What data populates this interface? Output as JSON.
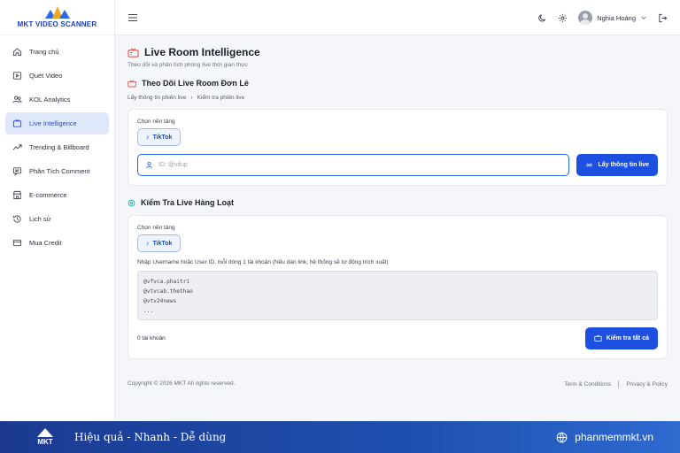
{
  "app": {
    "logo_text": "MKT VIDEO SCANNER"
  },
  "sidebar": {
    "items": [
      {
        "label": "Trang chủ",
        "icon": "home-icon"
      },
      {
        "label": "Quét Video",
        "icon": "video-icon"
      },
      {
        "label": "KOL Analytics",
        "icon": "users-icon"
      },
      {
        "label": "Live Intelligence",
        "icon": "live-icon",
        "active": true
      },
      {
        "label": "Trending & Billboard",
        "icon": "trending-icon"
      },
      {
        "label": "Phân Tích Comment",
        "icon": "comment-icon"
      },
      {
        "label": "E-commerce",
        "icon": "store-icon"
      },
      {
        "label": "Lịch sử",
        "icon": "history-icon"
      },
      {
        "label": "Mua Credit",
        "icon": "credit-card-icon"
      }
    ]
  },
  "topbar": {
    "user_name": "Nghia Hoàng"
  },
  "page": {
    "title": "Live Room Intelligence",
    "subtitle": "Theo dõi và phân tích phòng live thời gian thực"
  },
  "single": {
    "title": "Theo Dõi Live Room Đơn Lẻ",
    "breadcrumb": [
      "Lấy thông tin phiên live",
      "Kiểm tra phiên live"
    ],
    "platform_label": "Chọn nền tảng",
    "platform": "TikTok",
    "input_placeholder": "ID: @vifup",
    "submit_label": "Lấy thông tin live"
  },
  "bulk": {
    "title": "Kiểm Tra Live Hàng Loạt",
    "platform_label": "Chọn nền tảng",
    "platform": "TikTok",
    "hint": "Nhập Username hoặc User ID, mỗi dòng 1 tài khoản (Nếu dán link, hệ thống sẽ tự động trích xuất)",
    "placeholder_lines": [
      "@vfvca.phaitri",
      "@vtvcab.thethao",
      "@vtv24news",
      "..."
    ],
    "count_text": "0 tài khoản",
    "submit_label": "Kiểm tra tất cả"
  },
  "footer": {
    "copyright": "Copyright © 2026 MKT All rights reserved.",
    "terms": "Term & Conditions",
    "privacy": "Privacy & Policy"
  },
  "banner": {
    "logo": "MKT",
    "tagline": "Hiệu quả - Nhanh - Dễ dùng",
    "website": "phanmemmkt.vn"
  },
  "colors": {
    "accent": "#1d4fe0",
    "active_bg": "#dfe8fb",
    "banner": "#1e4fb0"
  }
}
